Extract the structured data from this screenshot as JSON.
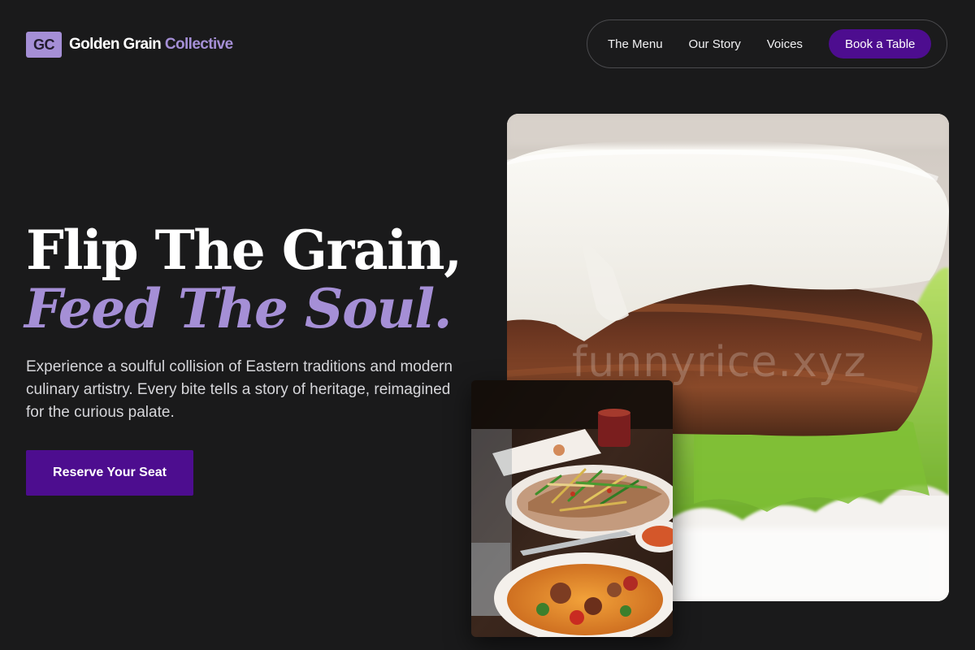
{
  "brand": {
    "badge": "GC",
    "name_primary": "Golden Grain",
    "name_accent": "Collective",
    "accent_color": "#a58fd6",
    "cta_color": "#4d0d8f"
  },
  "nav": {
    "links": [
      "The Menu",
      "Our Story",
      "Voices"
    ],
    "cta_label": "Book a Table"
  },
  "hero": {
    "title_line1": "Flip The Grain,",
    "title_line2": "Feed The Soul.",
    "description": "Experience a soulful collision of Eastern traditions and modern culinary artistry. Every bite tells a story of heritage, reimagined for the curious palate.",
    "cta_label": "Reserve Your Seat",
    "watermark": "funnyrice.xyz",
    "main_image_icon": "pork-bun-photo",
    "secondary_image_icon": "shared-dishes-photo"
  }
}
